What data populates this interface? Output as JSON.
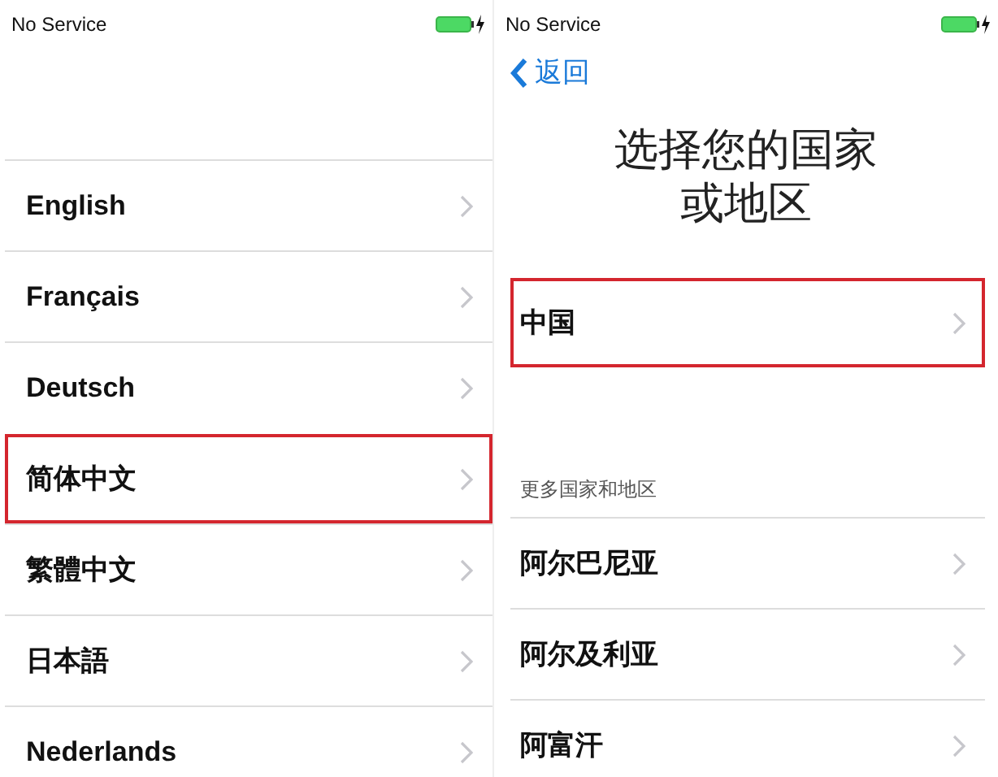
{
  "screens": [
    {
      "status_bar": {
        "carrier": "No Service"
      },
      "rows": [
        {
          "label": "English",
          "highlighted": false
        },
        {
          "label": "Français",
          "highlighted": false
        },
        {
          "label": "Deutsch",
          "highlighted": false
        },
        {
          "label": "简体中文",
          "highlighted": true
        },
        {
          "label": "繁體中文",
          "highlighted": false
        },
        {
          "label": "日本語",
          "highlighted": false
        },
        {
          "label": "Nederlands",
          "highlighted": false
        }
      ]
    },
    {
      "status_bar": {
        "carrier": "No Service"
      },
      "back": "返回",
      "title_lines": [
        "选择您的国家",
        "或地区"
      ],
      "rows": [
        {
          "label": "中国",
          "highlighted": true
        }
      ],
      "section_header": "更多国家和地区",
      "more_rows": [
        {
          "label": "阿尔巴尼亚",
          "highlighted": false
        },
        {
          "label": "阿尔及利亚",
          "highlighted": false
        },
        {
          "label": "阿富汗",
          "highlighted": false
        }
      ]
    }
  ]
}
